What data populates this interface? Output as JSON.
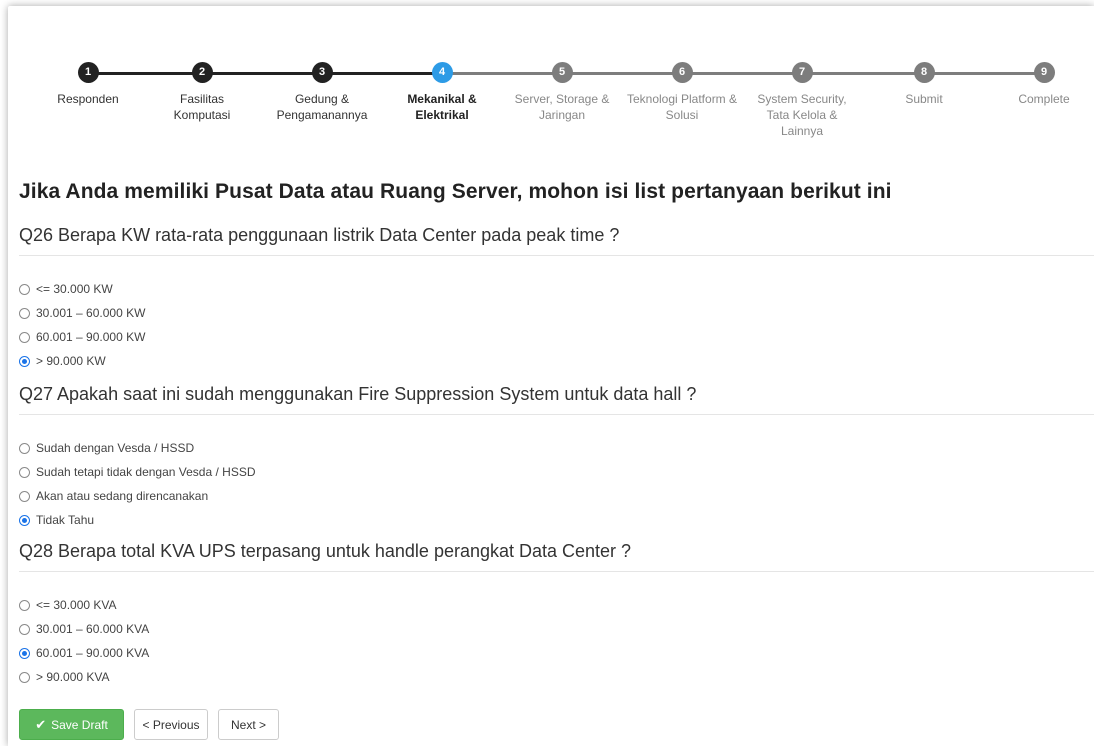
{
  "stepper": {
    "steps": [
      {
        "number": "1",
        "label": "Responden"
      },
      {
        "number": "2",
        "label": "Fasilitas Komputasi"
      },
      {
        "number": "3",
        "label": "Gedung & Pengamanannya"
      },
      {
        "number": "4",
        "label": "Mekanikal & Elektrikal"
      },
      {
        "number": "5",
        "label": "Server, Storage & Jaringan"
      },
      {
        "number": "6",
        "label": "Teknologi Platform & Solusi"
      },
      {
        "number": "7",
        "label": "System Security, Tata Kelola & Lainnya"
      },
      {
        "number": "8",
        "label": "Submit"
      },
      {
        "number": "9",
        "label": "Complete"
      }
    ],
    "active_step": 4
  },
  "page_title": "Jika Anda memiliki Pusat Data atau Ruang Server, mohon isi list pertanyaan berikut ini",
  "questions": [
    {
      "title": "Q26 Berapa KW rata-rata penggunaan listrik Data Center pada peak time ?",
      "options": [
        "<= 30.000 KW",
        "30.001 – 60.000 KW",
        "60.001 – 90.000 KW",
        "> 90.000 KW"
      ],
      "selected": 3
    },
    {
      "title": "Q27 Apakah saat ini sudah menggunakan Fire Suppression System untuk data hall ?",
      "options": [
        "Sudah dengan Vesda / HSSD",
        "Sudah tetapi tidak dengan Vesda / HSSD",
        "Akan atau sedang direncanakan",
        "Tidak Tahu"
      ],
      "selected": 3
    },
    {
      "title": "Q28 Berapa total KVA UPS terpasang untuk handle perangkat Data Center ?",
      "options": [
        "<= 30.000 KVA",
        "30.001 – 60.000 KVA",
        "60.001 – 90.000 KVA",
        "> 90.000 KVA"
      ],
      "selected": 2
    }
  ],
  "buttons": {
    "save_label": "Save Draft",
    "previous_label": "< Previous",
    "next_label": "Next >"
  },
  "colors": {
    "active_step": "#2d9be6",
    "done_step": "#222222",
    "todo_step": "#7d7d7d",
    "save_button": "#5cb85c",
    "radio_checked": "#1a73e8"
  }
}
